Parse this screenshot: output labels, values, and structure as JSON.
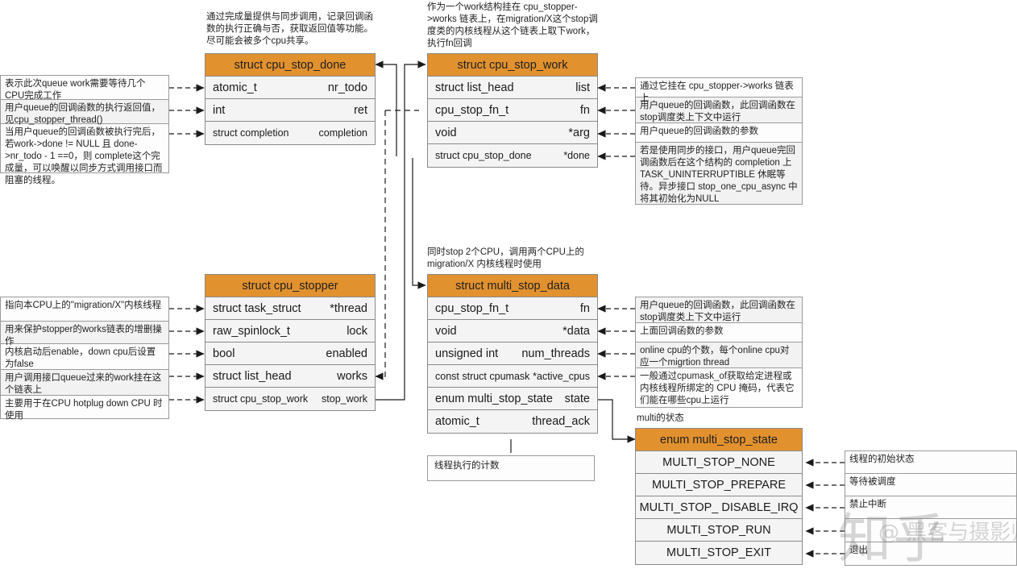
{
  "colors": {
    "header_orange": "#e2912f",
    "row_gray": "#f4f4f4",
    "border": "#8a8a8a",
    "note_border": "#9a9a9a"
  },
  "annotations": {
    "cpu_stop_done_note": "通过完成量提供与同步调用，记录回调函\n数的执行正确与否，获取返回值等功能。\n尽可能会被多个cpu共享。",
    "cpu_stop_work_note": "作为一个work结构挂在 cpu_stopper-\n>works 链表上，在migration/X这个stop调\n度类的内核线程从这个链表上取下work，\n执行fn回调",
    "multi_stop_data_note": "同时stop 2个CPU，调用两个CPU上的\nmigration/X 内核线程时使用",
    "multi_state_note": "multi的状态",
    "thread_ack_note": "线程执行的计数"
  },
  "structs": {
    "cpu_stop_done": {
      "title": "struct cpu_stop_done",
      "fields": [
        {
          "type": "atomic_t",
          "name": "nr_todo"
        },
        {
          "type": "int",
          "name": "ret"
        },
        {
          "type": "struct completion",
          "name": "completion"
        }
      ],
      "notes": [
        "表示此次queue work需要等待几个CPU完成工作",
        "用户queue的回调函数的执行返回值，见cpu_stopper_thread()",
        "当用户queue的回调函数被执行完后，若work->done != NULL 且 done->nr_todo - 1 ==0，则 complete这个完成量，可以唤醒以同步方式调用接口而阻塞的线程。"
      ]
    },
    "cpu_stop_work": {
      "title": "struct cpu_stop_work",
      "fields": [
        {
          "type": "struct list_head",
          "name": "list"
        },
        {
          "type": "cpu_stop_fn_t",
          "name": "fn"
        },
        {
          "type": "void",
          "name": "*arg"
        },
        {
          "type": "struct cpu_stop_done",
          "name": "*done"
        }
      ],
      "notes": [
        "通过它挂在 cpu_stopper->works 链表上",
        "用户queue的回调函数，此回调函数在stop调度类上下文中运行",
        "用户queue的回调函数的参数",
        "若是使用同步的接口，用户queue完回调函数后在这个结构的 completion 上 TASK_UNINTERRUPTIBLE 休眠等待。异步接口 stop_one_cpu_async 中将其初始化为NULL"
      ]
    },
    "cpu_stopper": {
      "title": "struct cpu_stopper",
      "fields": [
        {
          "type": "struct task_struct",
          "name": "*thread"
        },
        {
          "type": "raw_spinlock_t",
          "name": "lock"
        },
        {
          "type": "bool",
          "name": "enabled"
        },
        {
          "type": "struct list_head",
          "name": "works"
        },
        {
          "type": "struct cpu_stop_work",
          "name": "stop_work"
        }
      ],
      "notes": [
        "指向本CPU上的\"migration/X\"内核线程",
        "用来保护stopper的works链表的增删操作",
        "内核启动后enable，down cpu后设置为false",
        "用户调用接口queue过来的work挂在这个链表上",
        "主要用于在CPU hotplug down CPU 时使用"
      ]
    },
    "multi_stop_data": {
      "title": "struct multi_stop_data",
      "fields": [
        {
          "type": "cpu_stop_fn_t",
          "name": "fn"
        },
        {
          "type": "void",
          "name": "*data"
        },
        {
          "type": "unsigned int",
          "name": "num_threads"
        },
        {
          "type": "const struct cpumask",
          "name": "*active_cpus"
        },
        {
          "type": "enum multi_stop_state",
          "name": "state"
        },
        {
          "type": "atomic_t",
          "name": "thread_ack"
        }
      ],
      "notes": [
        "用户queue的回调函数，此回调函数在stop调度类上下文中运行",
        "上面回调函数的参数",
        "online cpu的个数，每个online cpu对应一个migrtion thread",
        "一般通过cpumask_of获取给定进程或内核线程所绑定的 CPU 掩码，代表它们能在哪些cpu上运行"
      ]
    },
    "multi_stop_state": {
      "title": "enum multi_stop_state",
      "values": [
        "MULTI_STOP_NONE",
        "MULTI_STOP_PREPARE",
        "MULTI_STOP_ DISABLE_IRQ",
        "MULTI_STOP_RUN",
        "MULTI_STOP_EXIT"
      ],
      "notes": [
        "线程的初始状态",
        "等待被调度",
        "禁止中断",
        "",
        "退出"
      ]
    }
  },
  "watermark": {
    "text": "@ 黑客与摄影师",
    "logo": "知乎"
  }
}
